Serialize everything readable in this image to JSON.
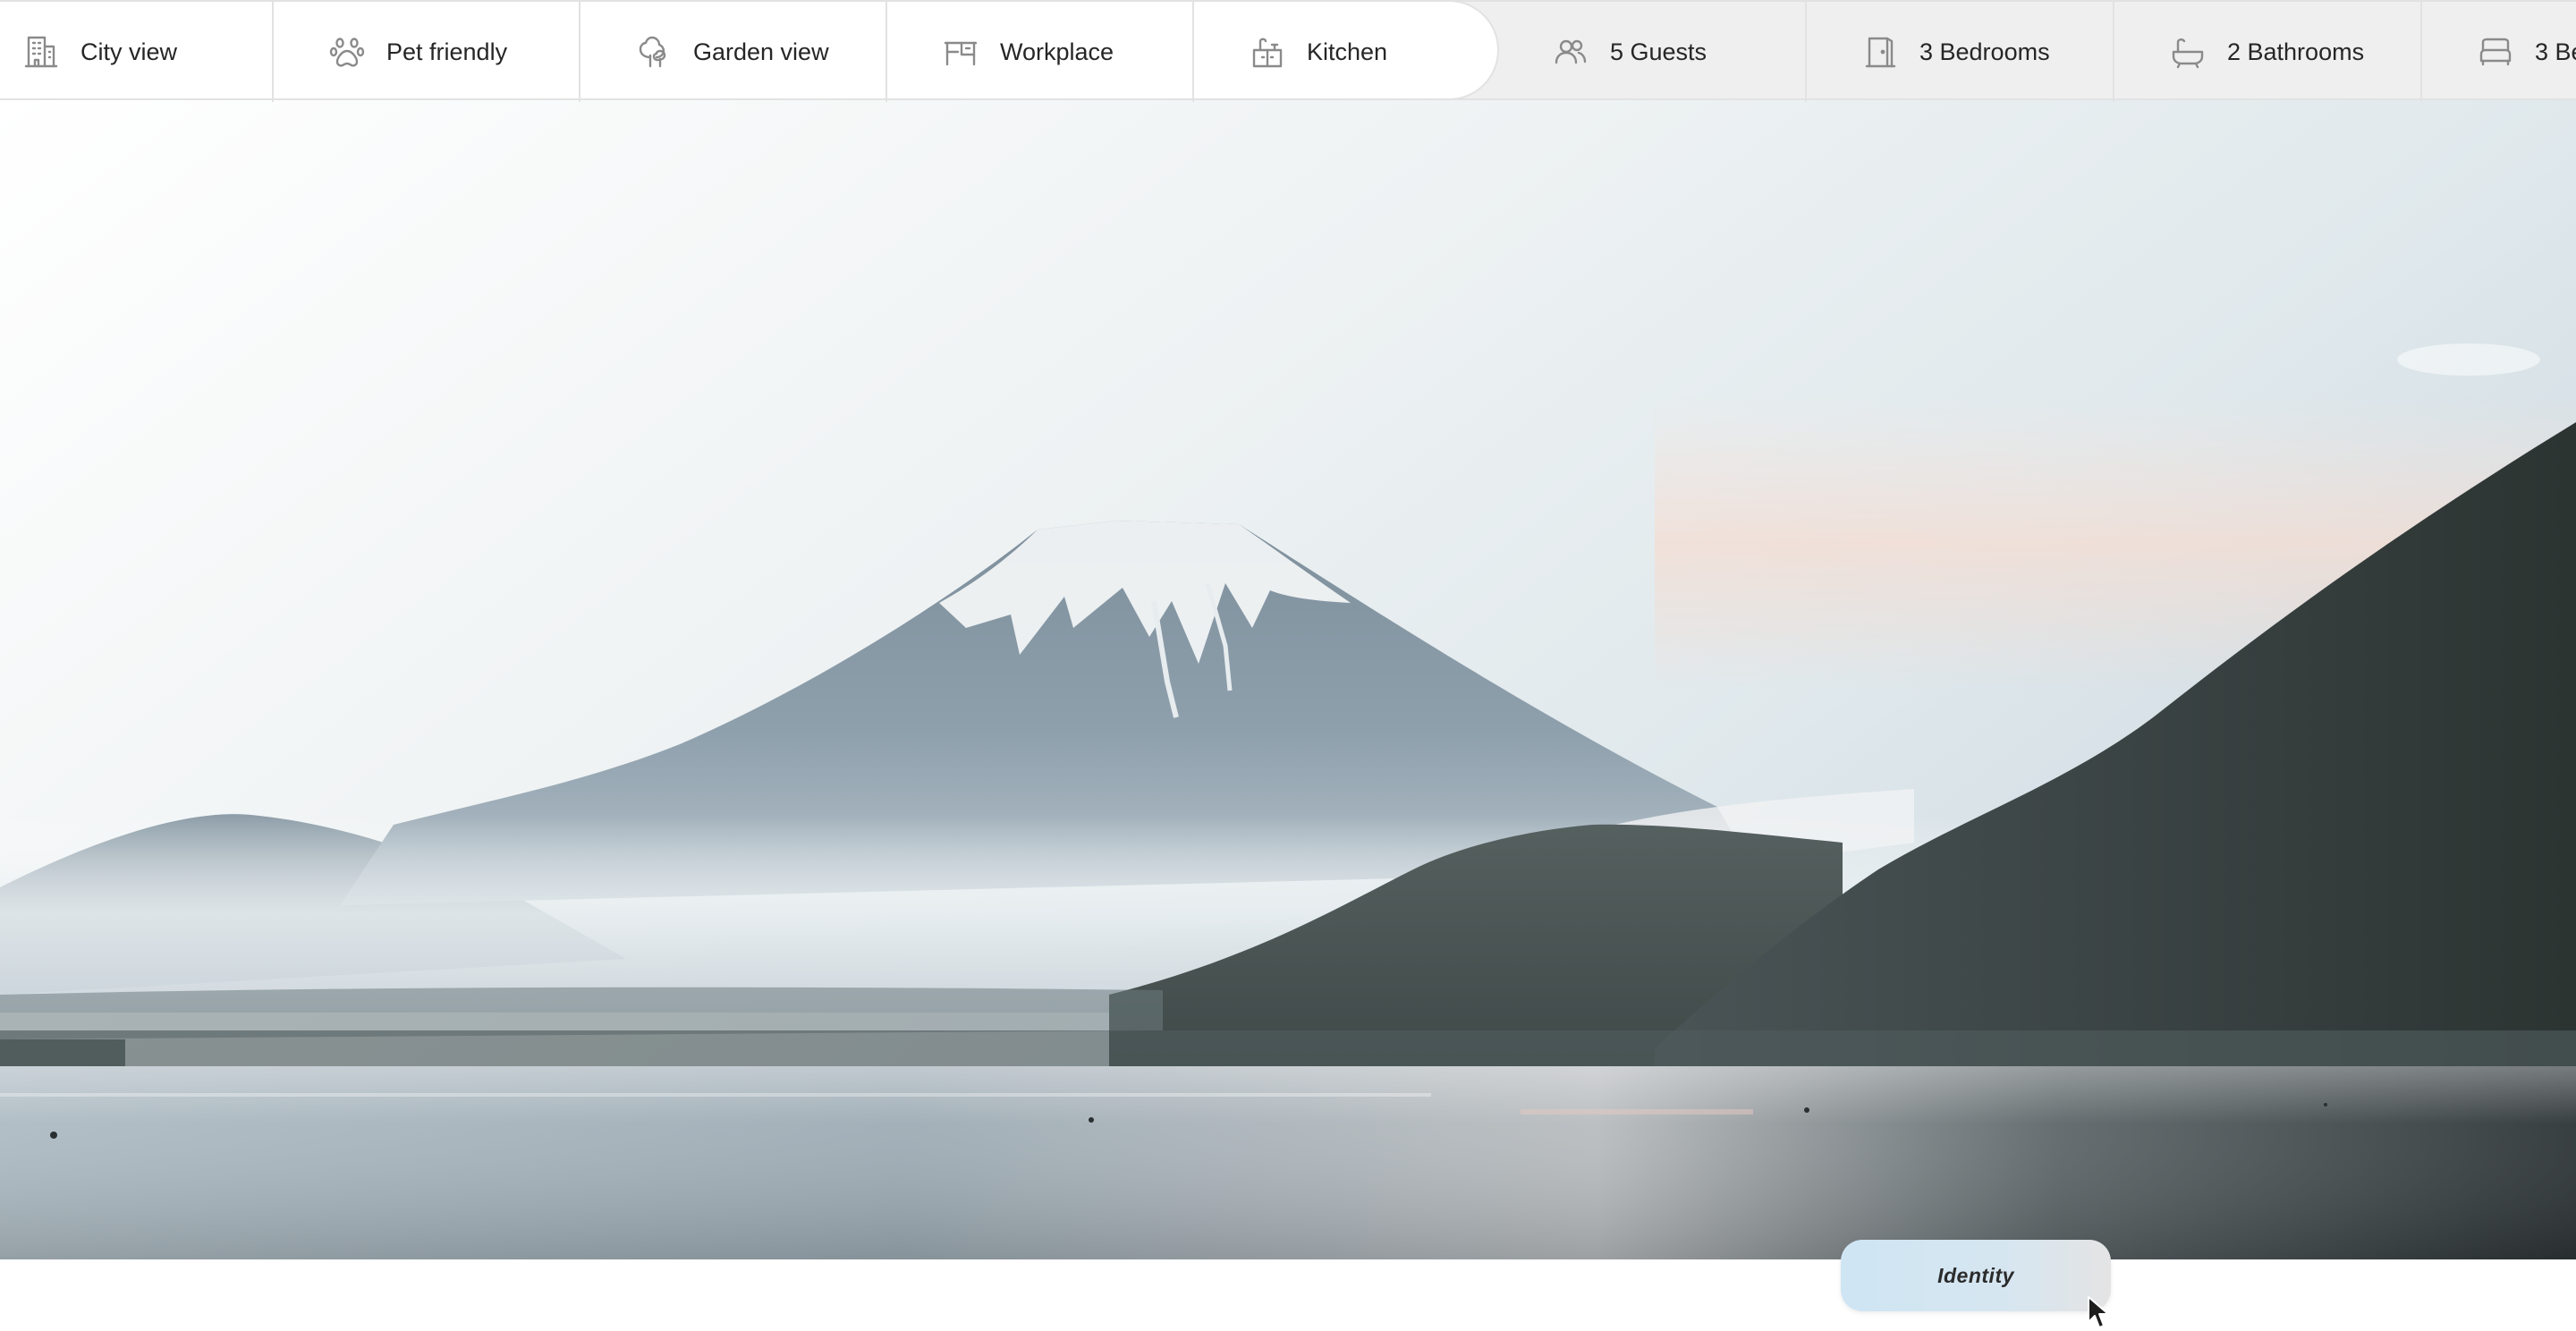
{
  "amenities": {
    "primary": [
      {
        "label": "City view",
        "icon": "building-icon"
      },
      {
        "label": "Pet friendly",
        "icon": "paw-icon"
      },
      {
        "label": "Garden view",
        "icon": "tree-icon"
      },
      {
        "label": "Workplace",
        "icon": "desk-icon"
      },
      {
        "label": "Kitchen",
        "icon": "kitchen-icon"
      }
    ],
    "capacity": [
      {
        "label": "5 Guests",
        "icon": "guests-icon"
      },
      {
        "label": "3 Bedrooms",
        "icon": "door-icon"
      },
      {
        "label": "2 Bathrooms",
        "icon": "bathtub-icon"
      },
      {
        "label": "3 Be",
        "icon": "bed-icon"
      }
    ]
  },
  "hero": {
    "subject": "mountain-lake-photo"
  },
  "badge": {
    "label": "Identity"
  },
  "colors": {
    "accent_badge": "#cfe5f3",
    "bar_grey": "#efefef",
    "border": "#e2e2e2",
    "text": "#262626",
    "icon": "#8a8a8a"
  }
}
